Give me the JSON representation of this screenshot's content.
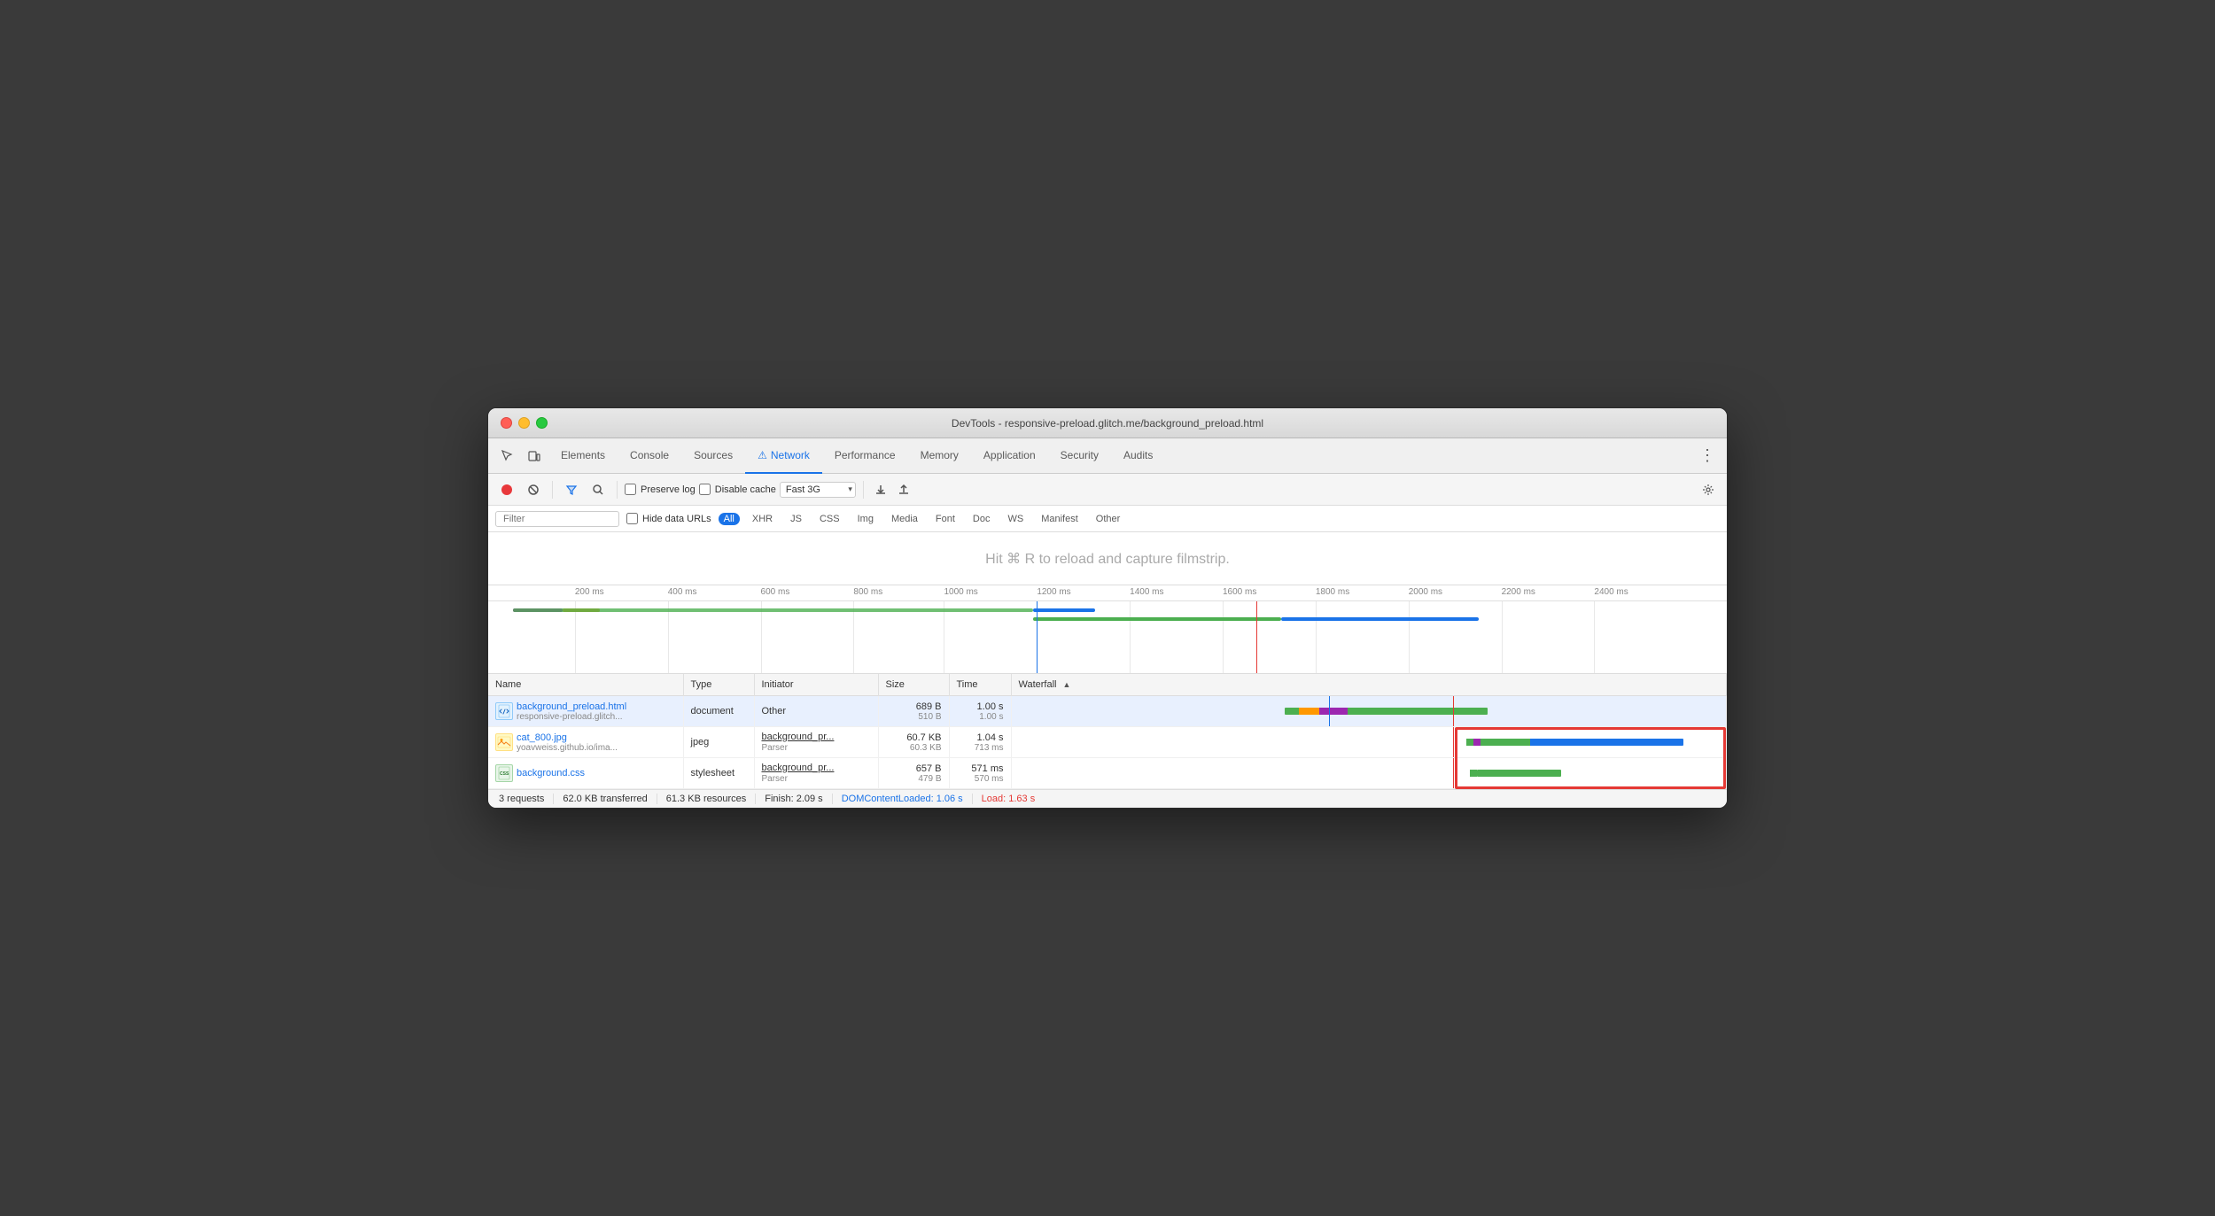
{
  "window": {
    "title": "DevTools - responsive-preload.glitch.me/background_preload.html"
  },
  "tabs": [
    {
      "label": "Elements",
      "active": false
    },
    {
      "label": "Console",
      "active": false
    },
    {
      "label": "Sources",
      "active": false
    },
    {
      "label": "Network",
      "active": true,
      "icon": "⚠"
    },
    {
      "label": "Performance",
      "active": false
    },
    {
      "label": "Memory",
      "active": false
    },
    {
      "label": "Application",
      "active": false
    },
    {
      "label": "Security",
      "active": false
    },
    {
      "label": "Audits",
      "active": false
    }
  ],
  "toolbar": {
    "preserve_log": "Preserve log",
    "disable_cache": "Disable cache",
    "throttle": "Fast 3G"
  },
  "filter_bar": {
    "placeholder": "Filter",
    "hide_data_urls": "Hide data URLs",
    "types": [
      "All",
      "XHR",
      "JS",
      "CSS",
      "Img",
      "Media",
      "Font",
      "Doc",
      "WS",
      "Manifest",
      "Other"
    ]
  },
  "filmstrip": {
    "message": "Hit ⌘ R to reload and capture filmstrip."
  },
  "timeline": {
    "marks": [
      {
        "label": "200 ms",
        "pct": 7.6
      },
      {
        "label": "400 ms",
        "pct": 15.1
      },
      {
        "label": "600 ms",
        "pct": 22.7
      },
      {
        "label": "800 ms",
        "pct": 30.3
      },
      {
        "label": "1000 ms",
        "pct": 37.8
      },
      {
        "label": "1200 ms",
        "pct": 45.4
      },
      {
        "label": "1400 ms",
        "pct": 53.0
      },
      {
        "label": "1600 ms",
        "pct": 60.5
      },
      {
        "label": "1800 ms",
        "pct": 68.1
      },
      {
        "label": "2000 ms",
        "pct": 75.6
      },
      {
        "label": "2200 ms",
        "pct": 83.2
      },
      {
        "label": "2400 ms",
        "pct": 90.8
      }
    ]
  },
  "table": {
    "columns": [
      "Name",
      "Type",
      "Initiator",
      "Size",
      "Time",
      "Waterfall"
    ],
    "rows": [
      {
        "name": "background_preload.html",
        "sub": "responsive-preload.glitch...",
        "type": "document",
        "initiator": "Other",
        "initiator_link": false,
        "size": "689 B",
        "size_sub": "510 B",
        "time": "1.00 s",
        "time_sub": "1.00 s",
        "icon_type": "html",
        "icon_label": "◁▷",
        "selected": true
      },
      {
        "name": "cat_800.jpg",
        "sub": "yoavweiss.github.io/ima...",
        "type": "jpeg",
        "initiator": "background_pr...",
        "initiator_sub": "Parser",
        "initiator_link": true,
        "size": "60.7 KB",
        "size_sub": "60.3 KB",
        "time": "1.04 s",
        "time_sub": "713 ms",
        "icon_type": "img",
        "icon_label": "🖼",
        "selected": false
      },
      {
        "name": "background.css",
        "sub": "",
        "type": "stylesheet",
        "initiator": "background_pr...",
        "initiator_sub": "Parser",
        "initiator_link": true,
        "size": "657 B",
        "size_sub": "479 B",
        "time": "571 ms",
        "time_sub": "570 ms",
        "icon_type": "css",
        "icon_label": "CSS",
        "selected": false
      }
    ]
  },
  "status_bar": {
    "requests": "3 requests",
    "transferred": "62.0 KB transferred",
    "resources": "61.3 KB resources",
    "finish": "Finish: 2.09 s",
    "dom_content_loaded": "DOMContentLoaded: 1.06 s",
    "load": "Load: 1.63 s"
  }
}
